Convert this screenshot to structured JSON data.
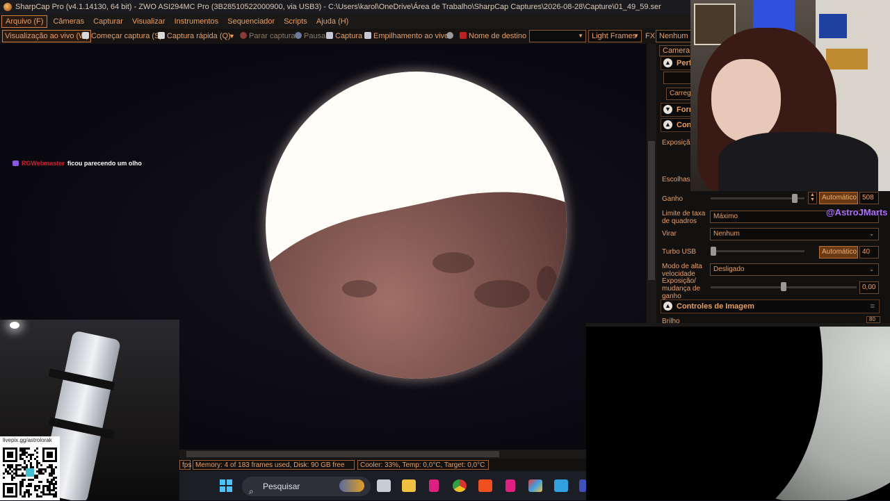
{
  "window": {
    "title": "SharpCap Pro (v4.1.14130, 64 bit) - ZWO ASI294MC Pro (3B28510522000900, via USB3) - C:\\Users\\karol\\OneDrive\\Área de Trabalho\\SharpCap Captures\\2026-08-28\\Capture\\01_49_59.ser"
  },
  "menu": {
    "items": [
      "Arquivo (F)",
      "Câmeras",
      "Capturar",
      "Visualizar",
      "Instrumentos",
      "Sequenciador",
      "Scripts",
      "Ajuda (H)"
    ]
  },
  "toolbar": {
    "live_view": "Visualização ao vivo (W)",
    "start_capture": "Começar captura (S)",
    "quick_capture": "Captura rápida (Q)",
    "stop_capture": "Parar captura",
    "pause": "Pausa",
    "snapshot": "Captura",
    "live_stack": "Empilhamento ao vivo",
    "target_name_label": "Nome de destino",
    "target_name_value": "",
    "frame_type": "Light Frames",
    "fx_label": "FX",
    "fx_value": "Nenhum"
  },
  "chat": {
    "user": "RGWebmaster",
    "message": "ficou parecendo um olho"
  },
  "panel": {
    "tab": "Camera C",
    "sections": {
      "profiles": "Perfi",
      "load": "Carreg",
      "format": "Form",
      "controls": "Cont",
      "image_controls": "Controles de Imagem"
    },
    "exposure_label": "Exposiçã",
    "choose_label": "Escolhas",
    "gain": {
      "label": "Ganho",
      "auto_label": "Automático",
      "value": "508",
      "level": 0.92
    },
    "frame_rate_limit": {
      "label": "Limite de taxa de quadros",
      "value": "Máximo"
    },
    "flip": {
      "label": "Virar",
      "value": "Nenhum"
    },
    "usb_turbo": {
      "label": "Turbo USB",
      "auto_label": "Automático",
      "value": "40",
      "level": 0.0
    },
    "high_speed_mode": {
      "label": "Modo de alta velocidade",
      "value": "Desligado"
    },
    "exposure_gain_change": {
      "label": "Exposição/ mudança de ganho",
      "value": "0,00",
      "level": 0.5
    },
    "brightness": {
      "label": "Brilho",
      "value": "80"
    }
  },
  "watermark": "@AstroJMarts",
  "qr_label": "livepix.gg/astrolorak",
  "status": {
    "fps": "fps",
    "memory": "Memory: 4 of 183 frames used, Disk: 90 GB free",
    "cooler": "Cooler: 33%, Temp: 0,0°C, Target: 0,0°C"
  },
  "taskbar": {
    "search_placeholder": "Pesquisar"
  },
  "colors": {
    "accent": "#e8a060",
    "watermark": "#b070ff",
    "chat_user": "#d02030"
  }
}
